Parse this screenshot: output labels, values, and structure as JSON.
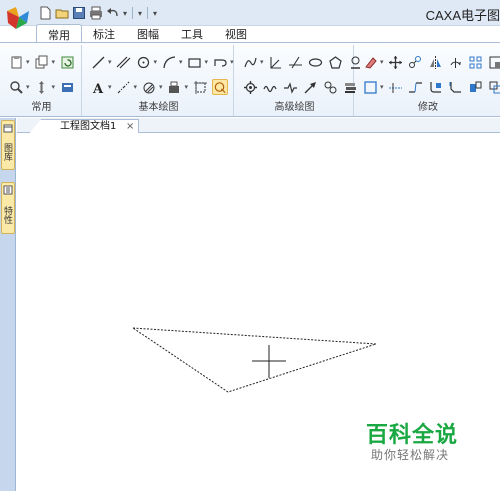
{
  "app": {
    "title": "CAXA电子图"
  },
  "quick_access": {
    "icons": [
      "new-file-icon",
      "open-folder-icon",
      "save-icon",
      "print-icon",
      "undo-icon",
      "redo-icon",
      "customize-icon"
    ]
  },
  "ribbon": {
    "tabs": [
      {
        "label": "常用",
        "active": true
      },
      {
        "label": "标注",
        "active": false
      },
      {
        "label": "图幅",
        "active": false
      },
      {
        "label": "工具",
        "active": false
      },
      {
        "label": "视图",
        "active": false
      }
    ],
    "groups": [
      {
        "label": "常用"
      },
      {
        "label": "基本绘图"
      },
      {
        "label": "高级绘图"
      },
      {
        "label": "修改"
      }
    ]
  },
  "side_panels": [
    {
      "label": "图库"
    },
    {
      "label": "特性"
    }
  ],
  "document": {
    "tab_label": "工程图文档1",
    "close_glyph": "×"
  },
  "watermark": {
    "title": "百科全说",
    "subtitle": "助你轻松解决"
  },
  "colors": {
    "ribbon_bg": "#eaf1fa",
    "active_tool": "#fde7a4",
    "watermark_green": "#1aa842"
  }
}
